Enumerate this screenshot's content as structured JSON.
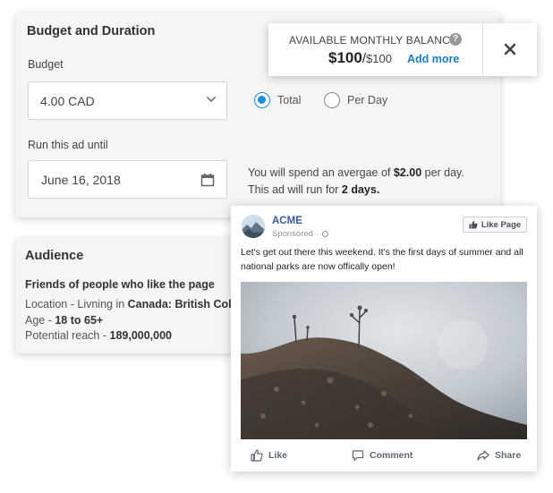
{
  "budget_section": {
    "title": "Budget and Duration",
    "budget_label": "Budget",
    "budget_value": "4.00 CAD",
    "options": [
      {
        "label": "Total",
        "selected": true
      },
      {
        "label": "Per Day",
        "selected": false
      }
    ],
    "run_until_label": "Run this ad until",
    "end_date": "June 16, 2018",
    "summary": {
      "line1_prefix": "You will spend an avergae of ",
      "daily_amount": "$2.00",
      "line1_suffix": " per day.",
      "line2_prefix": "This ad will run for ",
      "days": "2 days."
    }
  },
  "balance_popup": {
    "label": "AVAILABLE MONTHLY BALANCE",
    "help": "?",
    "amount": "$100",
    "separator": "/",
    "max": "$100",
    "add_more": "Add more",
    "close_icon": "close-icon"
  },
  "audience": {
    "title": "Audience",
    "subtitle": "Friends of people who like the page",
    "location_prefix": "Location - Livning in ",
    "location_value": "Canada: British Colu",
    "age_prefix": "Age - ",
    "age_value": "18 to 65+",
    "reach_prefix": "Potential reach - ",
    "reach_value": "189,000,000"
  },
  "post": {
    "page_name": "ACME",
    "sponsored": "Sponsored · ",
    "like_page": "Like Page",
    "text": "Let's get out there this weekend. It's the first days of summer and all national parks are now offically open!",
    "actions": [
      "Like",
      "Comment",
      "Share"
    ]
  },
  "colors": {
    "accent": "#1a8fd6",
    "link": "#1a7fc3",
    "facebook_blue": "#3b5998",
    "card_bg": "#f5f5f5"
  }
}
